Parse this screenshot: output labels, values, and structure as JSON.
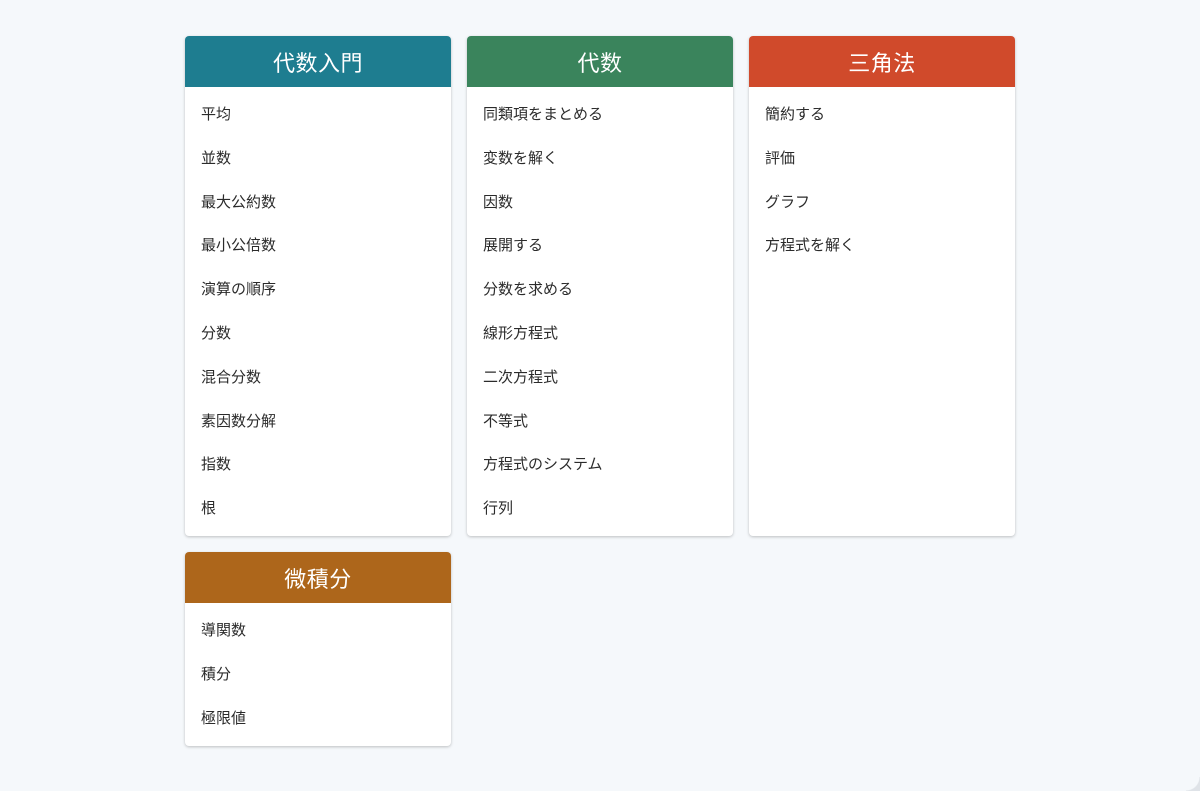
{
  "cards": [
    {
      "title": "代数入門",
      "color": "#1e7d90",
      "topics": [
        "平均",
        "並数",
        "最大公約数",
        "最小公倍数",
        "演算の順序",
        "分数",
        "混合分数",
        "素因数分解",
        "指数",
        "根"
      ]
    },
    {
      "title": "代数",
      "color": "#3a845c",
      "topics": [
        "同類項をまとめる",
        "変数を解く",
        "因数",
        "展開する",
        "分数を求める",
        "線形方程式",
        "二次方程式",
        "不等式",
        "方程式のシステム",
        "行列"
      ]
    },
    {
      "title": "三角法",
      "color": "#d04a2b",
      "topics": [
        "簡約する",
        "評価",
        "グラフ",
        "方程式を解く"
      ]
    },
    {
      "title": "微積分",
      "color": "#ad661b",
      "topics": [
        "導関数",
        "積分",
        "極限値"
      ]
    }
  ]
}
